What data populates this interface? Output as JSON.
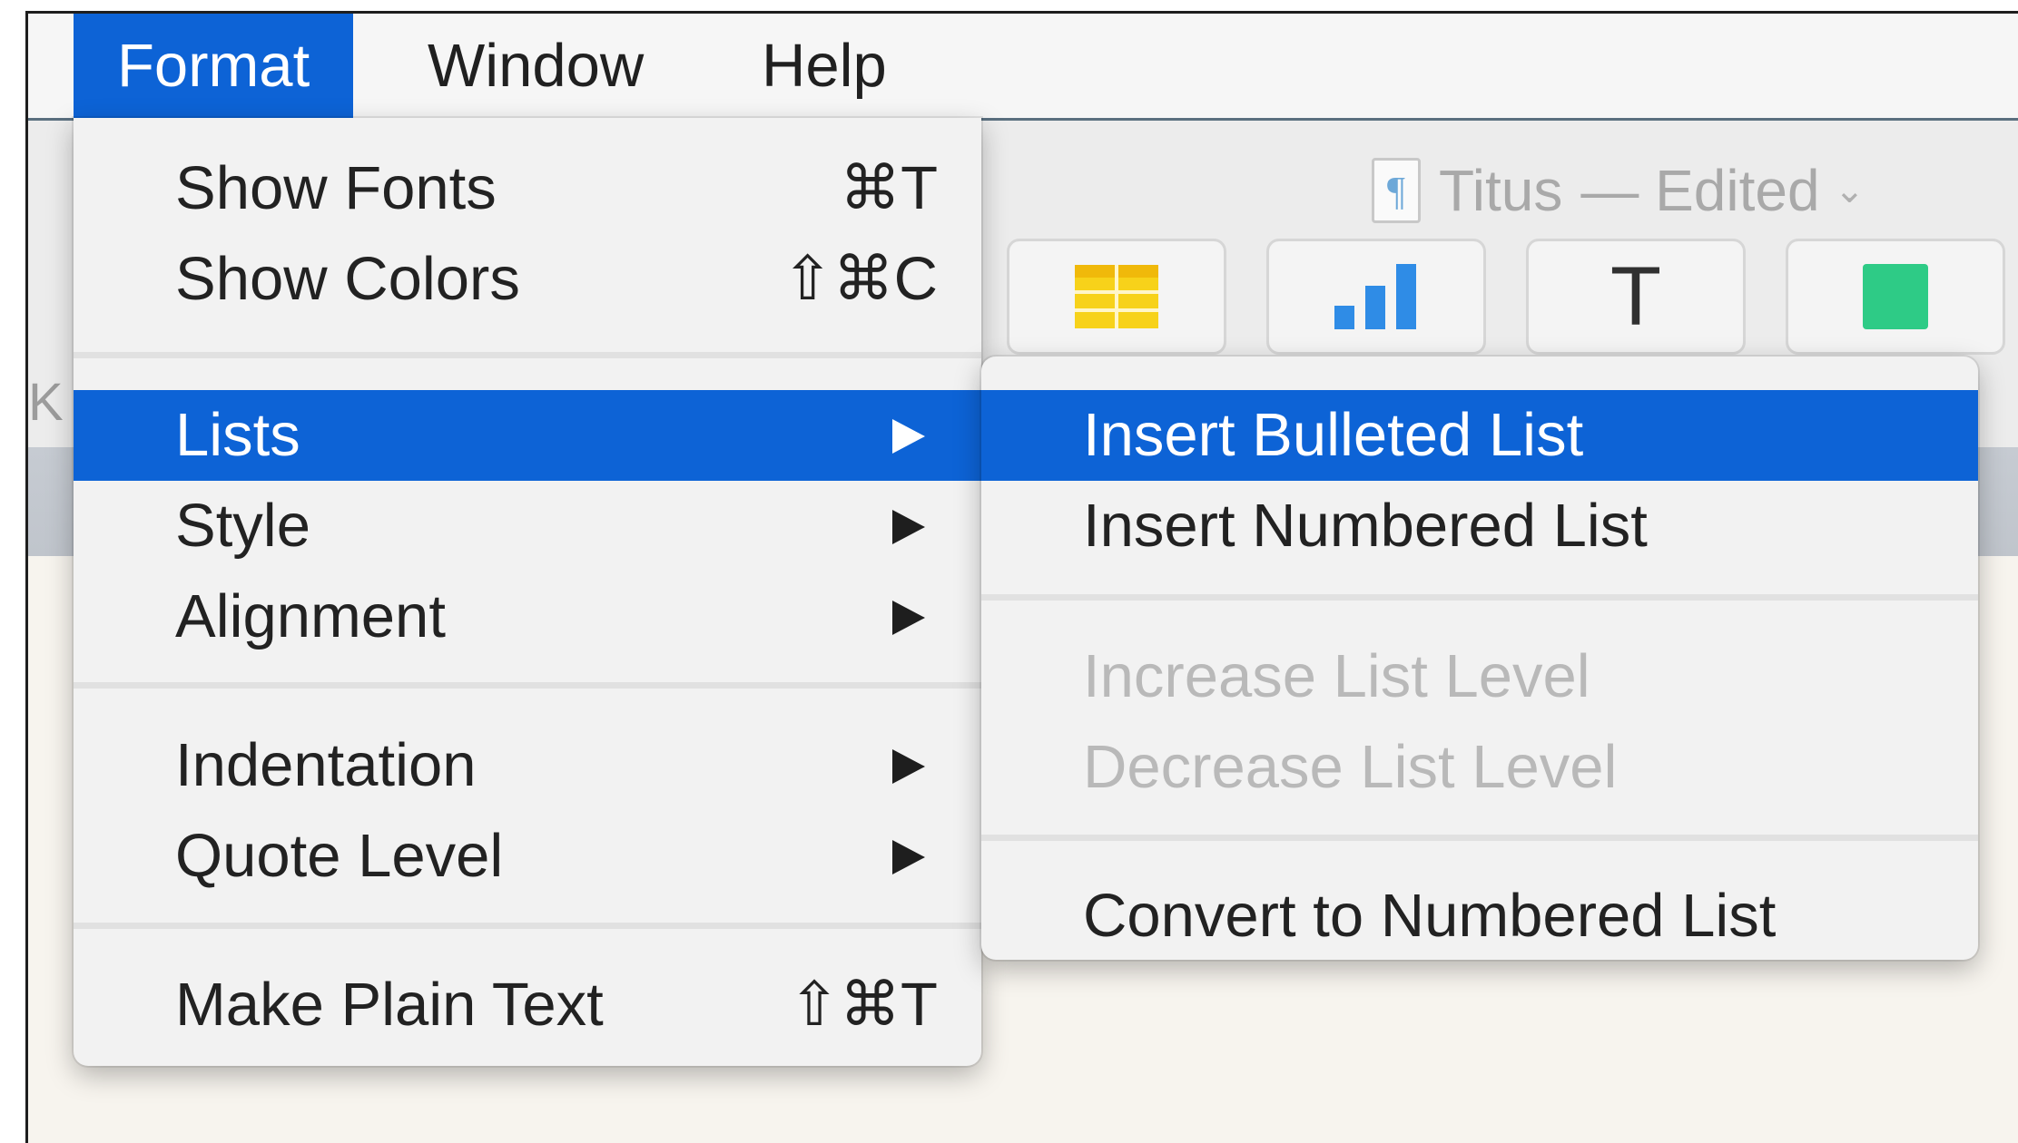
{
  "menubar": {
    "items": [
      "Format",
      "Window",
      "Help"
    ],
    "active": "Format"
  },
  "document": {
    "name": "Titus",
    "status": "— Edited",
    "chevron": "⌄"
  },
  "ruler_text": "K",
  "toolbar": {
    "buttons": [
      "table-icon",
      "chart-icon",
      "text-box-icon",
      "shape-icon"
    ],
    "text_glyph": "T"
  },
  "format_menu": {
    "show_fonts": {
      "label": "Show Fonts",
      "shortcut": "⌘T"
    },
    "show_colors": {
      "label": "Show Colors",
      "shortcut": "⇧⌘C"
    },
    "lists": {
      "label": "Lists"
    },
    "style": {
      "label": "Style"
    },
    "alignment": {
      "label": "Alignment"
    },
    "indentation": {
      "label": "Indentation"
    },
    "quote_level": {
      "label": "Quote Level"
    },
    "make_plain_text": {
      "label": "Make Plain Text",
      "shortcut": "⇧⌘T"
    }
  },
  "lists_submenu": {
    "insert_bulleted": "Insert Bulleted List",
    "insert_numbered": "Insert Numbered List",
    "increase_level": "Increase List Level",
    "decrease_level": "Decrease List Level",
    "convert_numbered": "Convert to Numbered List"
  },
  "colors": {
    "accent": "#0d63d6",
    "table_yellow": "#f7d21a",
    "chart_blue": "#2f8ce6",
    "shape_green": "#2ecb86"
  }
}
